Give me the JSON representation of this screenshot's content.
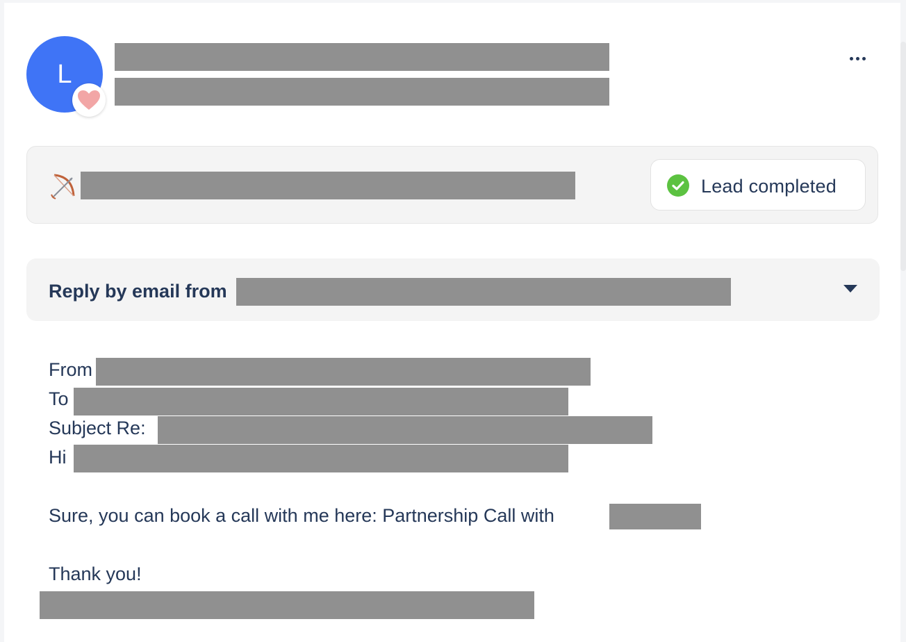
{
  "avatar": {
    "initial": "L",
    "color": "#3f74f6"
  },
  "status": {
    "label": "Lead completed",
    "color": "#5cc241"
  },
  "reply": {
    "label": "Reply by email from"
  },
  "email": {
    "from_label": "From",
    "to_label": "To",
    "subject_label": "Subject Re:",
    "greeting": "Hi",
    "body": "Sure, you can book a call with me here: Partnership Call with",
    "closing": "Thank you!"
  }
}
